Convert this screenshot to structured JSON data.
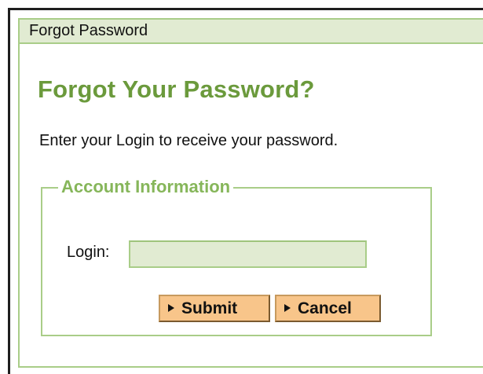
{
  "panel": {
    "title": "Forgot Password"
  },
  "main": {
    "heading": "Forgot Your Password?",
    "instructions": "Enter your Login to receive your password."
  },
  "form": {
    "legend": "Account Information",
    "login_label": "Login:",
    "login_value": "",
    "login_placeholder": "",
    "submit_label": "Submit",
    "cancel_label": "Cancel"
  },
  "icons": {
    "submit_icon": "play-triangle-icon",
    "cancel_icon": "play-triangle-icon"
  },
  "colors": {
    "accent_green": "#6b9a3c",
    "header_bg": "#e1ebd2",
    "border_green": "#a9cd88",
    "button_orange": "#f8c58a"
  }
}
